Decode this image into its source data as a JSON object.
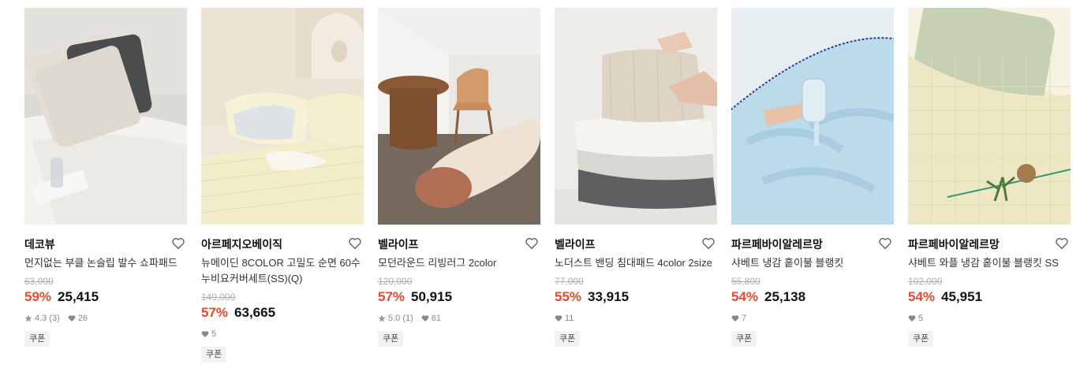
{
  "products": [
    {
      "brand": "데코뷰",
      "name": "먼지없는 부클 논슬립 발수 쇼파패드",
      "original_price": "63,000",
      "discount": "59%",
      "price": "25,415",
      "rating": "4.3",
      "reviews": "(3)",
      "likes": "26",
      "coupon": "쿠폰"
    },
    {
      "brand": "아르페지오베이직",
      "name": "뉴메이딘 8COLOR 고밀도 순면 60수 누비요커버세트(SS)(Q)",
      "original_price": "149,000",
      "discount": "57%",
      "price": "63,665",
      "likes": "5",
      "coupon": "쿠폰"
    },
    {
      "brand": "벨라이프",
      "name": "모던라운드 리빙러그 2color",
      "original_price": "120,000",
      "discount": "57%",
      "price": "50,915",
      "rating": "5.0",
      "reviews": "(1)",
      "likes": "61",
      "coupon": "쿠폰"
    },
    {
      "brand": "벨라이프",
      "name": "노더스트 밴딩 침대패드 4color 2size",
      "original_price": "77,000",
      "discount": "55%",
      "price": "33,915",
      "likes": "11",
      "coupon": "쿠폰"
    },
    {
      "brand": "파르페바이알레르망",
      "name": "샤베트 냉감 홑이불 블랭킷",
      "original_price": "55,800",
      "discount": "54%",
      "price": "25,138",
      "likes": "7",
      "coupon": "쿠폰"
    },
    {
      "brand": "파르페바이알레르망",
      "name": "샤베트 와플 냉감 홑이불 블랭킷 SS",
      "original_price": "102,000",
      "discount": "54%",
      "price": "45,951",
      "likes": "5",
      "coupon": "쿠폰"
    }
  ],
  "colors": {
    "discount": "#ef4826",
    "muted": "#888888",
    "coupon_bg": "#f2f2f2"
  },
  "icons": {
    "wish": "heart-outline-icon",
    "rating": "star-icon",
    "likes": "heart-filled-icon"
  }
}
